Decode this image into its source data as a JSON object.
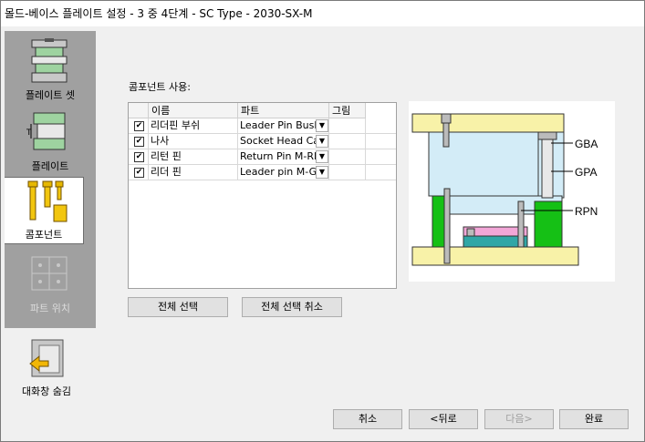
{
  "window": {
    "title": "몰드-베이스 플레이트 설정 - 3 중 4단계  - SC Type - 2030-SX-M"
  },
  "nav": {
    "items": [
      {
        "label": "플레이트 셋",
        "icon": "plate-set-icon"
      },
      {
        "label": "플레이트",
        "icon": "plate-icon"
      },
      {
        "label": "콤포넌트",
        "icon": "component-icon"
      },
      {
        "label": "파트 위치",
        "icon": "part-position-icon"
      }
    ],
    "hide_dialog_label": "대화창 숨김"
  },
  "components": {
    "section_label": "콤포넌트 사용:",
    "columns": [
      "이름",
      "파트",
      "그림"
    ],
    "rows": [
      {
        "checked": true,
        "name": "리더핀 부쉬",
        "part": "Leader Pin Bushi..."
      },
      {
        "checked": true,
        "name": "나사",
        "part": "Socket Head Ca..."
      },
      {
        "checked": true,
        "name": "리턴 핀",
        "part": "Return Pin M-RPN"
      },
      {
        "checked": true,
        "name": "리더 핀",
        "part": "Leader pin M-GPA"
      }
    ],
    "select_all": "전체 선택",
    "deselect_all": "전체 선택 취소"
  },
  "preview": {
    "labels": [
      "GBA",
      "GPA",
      "RPN"
    ]
  },
  "footer": {
    "cancel": "취소",
    "back": "<뒤로",
    "next": "다음>",
    "finish": "완료"
  }
}
